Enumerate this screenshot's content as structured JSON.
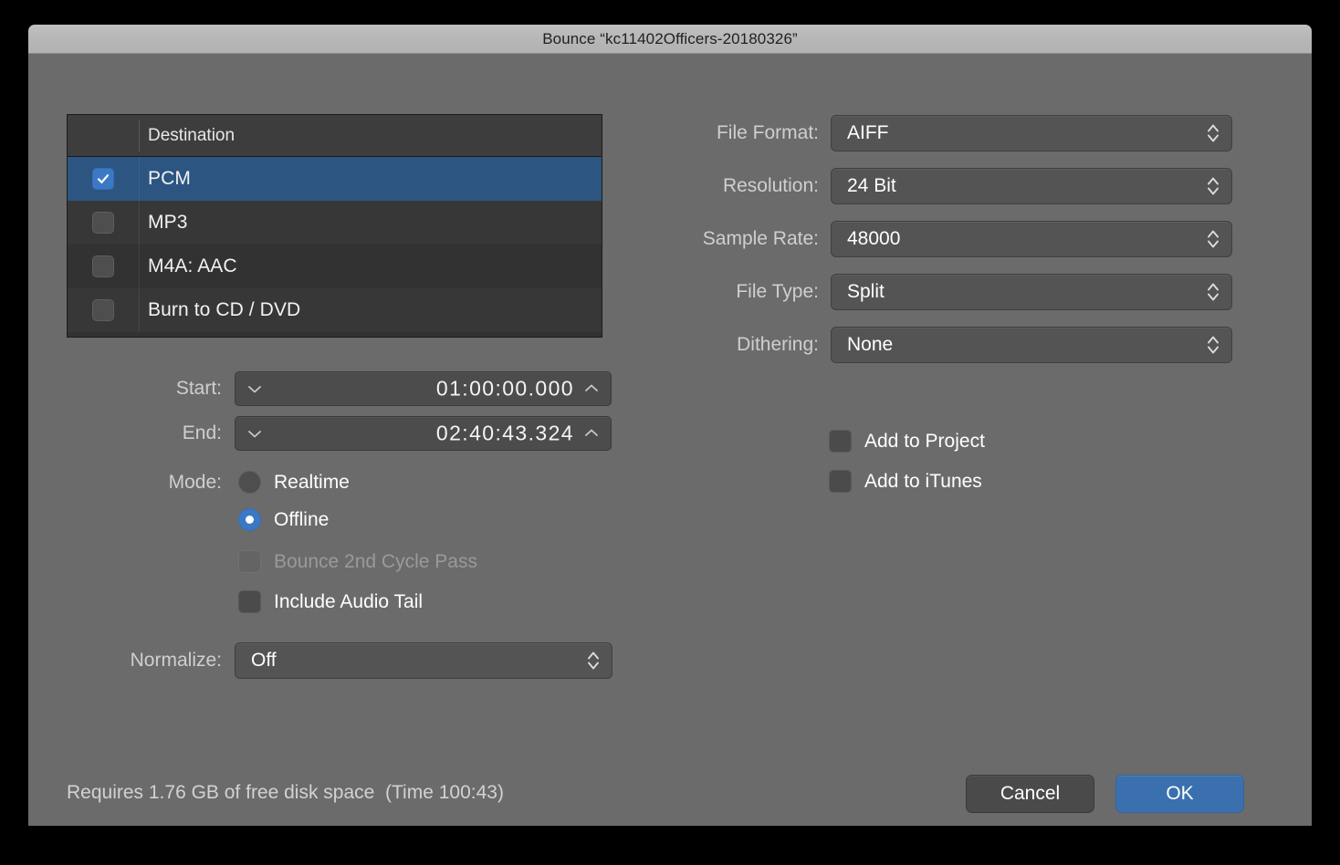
{
  "window": {
    "title": "Bounce “kc11402Officers-20180326”"
  },
  "destination_table": {
    "column_header": "Destination",
    "rows": [
      {
        "label": "PCM",
        "checked": true,
        "selected": true
      },
      {
        "label": "MP3",
        "checked": false,
        "selected": false
      },
      {
        "label": "M4A: AAC",
        "checked": false,
        "selected": false
      },
      {
        "label": "Burn to CD / DVD",
        "checked": false,
        "selected": false
      }
    ]
  },
  "left_panel": {
    "start": {
      "label": "Start:",
      "value": "01:00:00.000"
    },
    "end": {
      "label": "End:",
      "value": "02:40:43.324"
    },
    "mode": {
      "label": "Mode:",
      "options": [
        {
          "label": "Realtime",
          "selected": false
        },
        {
          "label": "Offline",
          "selected": true
        }
      ]
    },
    "bounce_2nd_cycle_pass": {
      "label": "Bounce 2nd Cycle Pass",
      "checked": false,
      "disabled": true
    },
    "include_audio_tail": {
      "label": "Include Audio Tail",
      "checked": false,
      "disabled": false
    },
    "normalize": {
      "label": "Normalize:",
      "value": "Off"
    }
  },
  "right_panel": {
    "file_format": {
      "label": "File Format:",
      "value": "AIFF"
    },
    "resolution": {
      "label": "Resolution:",
      "value": "24 Bit"
    },
    "sample_rate": {
      "label": "Sample Rate:",
      "value": "48000"
    },
    "file_type": {
      "label": "File Type:",
      "value": "Split"
    },
    "dithering": {
      "label": "Dithering:",
      "value": "None"
    },
    "add_to_project": {
      "label": "Add to Project",
      "checked": false
    },
    "add_to_itunes": {
      "label": "Add to iTunes",
      "checked": false
    }
  },
  "footer": {
    "status": "Requires 1.76 GB of free disk space  (Time 100:43)",
    "cancel_label": "Cancel",
    "ok_label": "OK"
  },
  "colors": {
    "accent_blue": "#3b79c4",
    "default_button_blue": "#3a70ad",
    "selected_row_blue": "#2c5582",
    "dialog_background": "#6b6b6b",
    "titlebar_gray": "#b6b6b6",
    "table_background": "#323232"
  }
}
